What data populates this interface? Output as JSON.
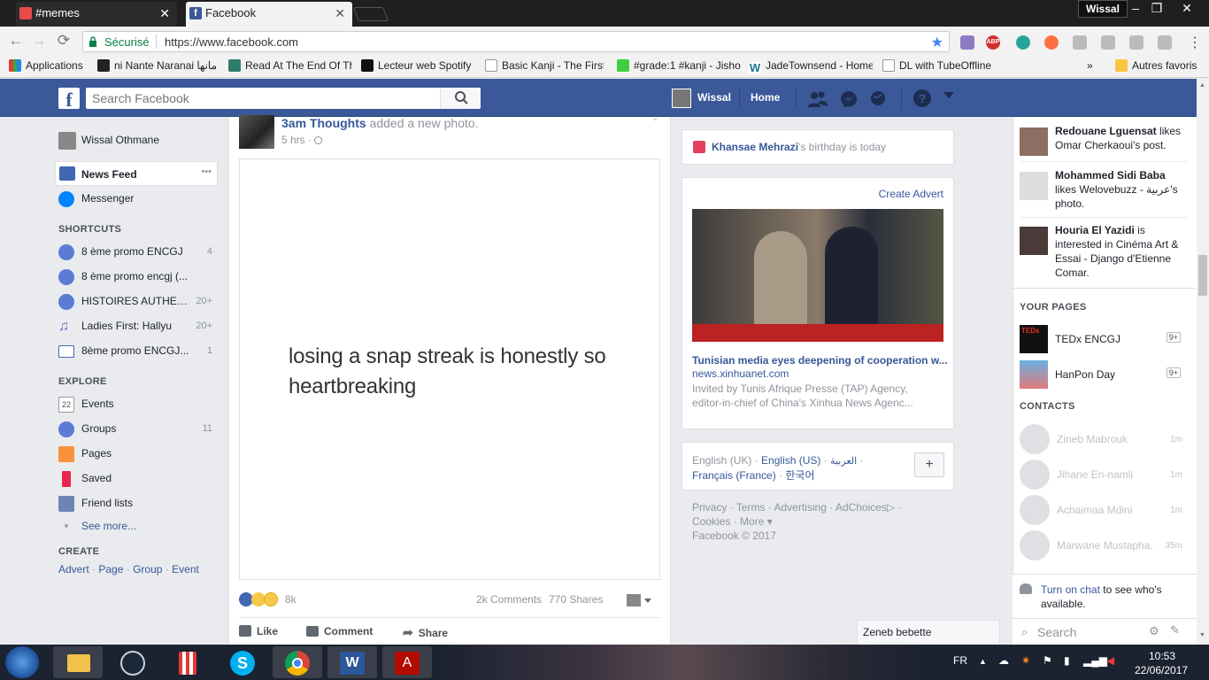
{
  "browser": {
    "tabs": [
      {
        "label": "#memes",
        "icon": "memes-favicon",
        "color": "#e64a4a"
      },
      {
        "label": "Facebook",
        "icon": "facebook-favicon",
        "color": "#3b5998"
      }
    ],
    "profile_name": "Wissal",
    "secure_label": "Sécurisé",
    "url": "https://www.facebook.com",
    "bookmarks": [
      "Applications",
      "ni Nante Naranai مانها",
      "Read At The End Of Th",
      "Lecteur web Spotify",
      "Basic Kanji - The First",
      "#grade:1 #kanji - Jisho",
      "JadeTownsend - Home",
      "DL with TubeOffline"
    ],
    "bookmarks_overflow": "»",
    "other_bookmarks": "Autres favoris"
  },
  "fb": {
    "search_placeholder": "Search Facebook",
    "user_name": "Wissal",
    "home_label": "Home",
    "brand_color": "#3b5998"
  },
  "left": {
    "profile_name": "Wissal Othmane",
    "news_feed": "News Feed",
    "more_dots": "•••",
    "messenger": "Messenger",
    "shortcuts_title": "SHORTCUTS",
    "shortcuts": [
      {
        "label": "8 ème promo ENCGJ",
        "count": "4"
      },
      {
        "label": "8 ème promo encgj (...",
        "count": ""
      },
      {
        "label": "HISTOIRES AUTHEN...",
        "count": "20+"
      },
      {
        "label": "Ladies First: Hallyu",
        "count": "20+"
      },
      {
        "label": "8ème promo ENCGJ...",
        "count": "1"
      }
    ],
    "explore_title": "EXPLORE",
    "explore": [
      {
        "label": "Events",
        "count": "",
        "icon": "calendar-icon",
        "badge": "22"
      },
      {
        "label": "Groups",
        "count": "11",
        "icon": "groups-icon"
      },
      {
        "label": "Pages",
        "count": "",
        "icon": "flag-icon"
      },
      {
        "label": "Saved",
        "count": "",
        "icon": "bookmark-icon"
      },
      {
        "label": "Friend lists",
        "count": "",
        "icon": "friend-list-icon"
      }
    ],
    "see_more": "See more...",
    "create_title": "CREATE",
    "create_links": [
      "Advert",
      "Page",
      "Group",
      "Event"
    ],
    "create_sep": "·"
  },
  "post": {
    "author": "3am Thoughts",
    "action": " added a new photo.",
    "time": "5 hrs",
    "time_sep": "·",
    "image_text": "losing a snap streak is honestly so heartbreaking",
    "reactions_count": "8k",
    "comments": "2k Comments",
    "shares": "770 Shares",
    "like": "Like",
    "comment": "Comment",
    "share": "Share"
  },
  "right": {
    "birthday_name": "Khansae Mehrazi",
    "birthday_text": "'s birthday is today",
    "create_advert": "Create Advert",
    "ad_title": "Tunisian media eyes deepening of cooperation w...",
    "ad_domain": "news.xinhuanet.com",
    "ad_desc": "Invited by Tunis Afrique Presse (TAP) Agency, editor-in-chief of China's Xinhua News Agenc...",
    "lang_current": "English (UK)",
    "langs": [
      "English (US)",
      "العربية",
      "Français (France)",
      "한국어"
    ],
    "lang_sep": "·",
    "lang_add": "+",
    "footer_line1": [
      "Privacy",
      "Terms",
      "Advertising",
      "AdChoices"
    ],
    "footer_line2": [
      "Cookies",
      "More"
    ],
    "more_caret": "▾",
    "copyright": "Facebook © 2017",
    "chat_tab": "Zeneb bebette"
  },
  "ticker": {
    "stories": [
      {
        "name": "Redouane Lguensat",
        "text": " likes Omar Cherkaoui's post."
      },
      {
        "name": "Mohammed Sidi Baba",
        "text": " likes Welovebuzz - عربية's photo."
      },
      {
        "name": "Houria El Yazidi",
        "text": " is interested in Cinéma Art & Essai - Django d'Etienne Comar."
      }
    ],
    "your_pages_title": "YOUR PAGES",
    "pages": [
      {
        "name": "TEDx ENCGJ",
        "badge": "9+"
      },
      {
        "name": "HanPon Day",
        "badge": "9+"
      }
    ],
    "contacts_title": "CONTACTS",
    "contacts": [
      {
        "name": "Zineb Mabrouk",
        "time": "1m"
      },
      {
        "name": "Jihane En-namli",
        "time": "1m"
      },
      {
        "name": "Achaimaa Mdini",
        "time": "1m"
      },
      {
        "name": "Marwane Mustapha...",
        "time": "35m"
      }
    ],
    "turn_on_chat": "Turn on chat",
    "turn_on_rest": " to see who's available.",
    "chat_search": "Search"
  },
  "taskbar": {
    "lang": "FR",
    "time": "10:53",
    "date": "22/06/2017"
  }
}
